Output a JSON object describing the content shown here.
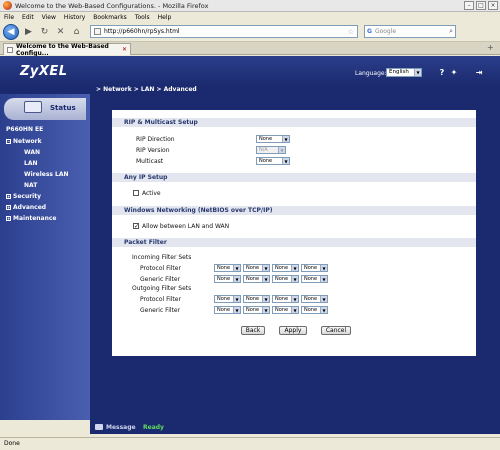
{
  "browser": {
    "window_title": "Welcome to the Web-Based Configurations. - Mozilla Firefox",
    "menu": [
      "File",
      "Edit",
      "View",
      "History",
      "Bookmarks",
      "Tools",
      "Help"
    ],
    "url": "http://p660hn/rpSys.html",
    "search_placeholder": "Google",
    "tab_title": "Welcome to the Web-Based Configu...",
    "status": "Done"
  },
  "router": {
    "logo": "ZyXEL",
    "language_label": "Language:",
    "language_value": "English",
    "breadcrumb": "> Network > LAN > Advanced",
    "status_tab": "Status",
    "device": "P660HN EE",
    "nav": {
      "network": "Network",
      "wan": "WAN",
      "lan": "LAN",
      "wireless": "Wireless LAN",
      "nat": "NAT",
      "security": "Security",
      "advanced": "Advanced",
      "maintenance": "Maintenance"
    }
  },
  "form": {
    "rip_title": "RIP & Multicast Setup",
    "rip_direction_label": "RIP Direction",
    "rip_direction_value": "None",
    "rip_version_label": "RIP Version",
    "rip_version_value": "N/A",
    "multicast_label": "Multicast",
    "multicast_value": "None",
    "anyip_title": "Any IP Setup",
    "active_label": "Active",
    "netbios_title": "Windows Networking (NetBIOS over TCP/IP)",
    "allow_label": "Allow between LAN and WAN",
    "packet_title": "Packet Filter",
    "incoming_label": "Incoming Filter Sets",
    "outgoing_label": "Outgoing Filter Sets",
    "protocol_filter": "Protocol Filter",
    "generic_filter": "Generic Filter",
    "filter_value": "None",
    "back": "Back",
    "apply": "Apply",
    "cancel": "Cancel"
  },
  "message": {
    "label": "Message",
    "value": "Ready"
  }
}
